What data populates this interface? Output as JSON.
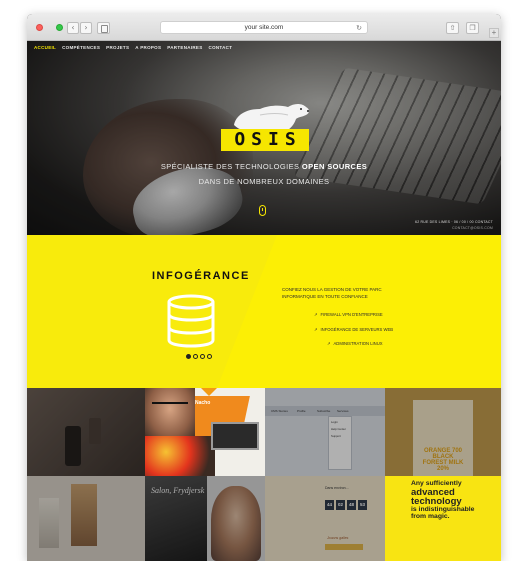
{
  "browser": {
    "url": "your site.com",
    "back_icon": "‹",
    "forward_icon": "›",
    "reload_icon": "↻",
    "share_icon": "⇧",
    "tabs_icon": "❐",
    "newtab_icon": "+"
  },
  "nav": {
    "items": [
      "Accueil",
      "Compétences",
      "Projets",
      "A propos",
      "Partenaires",
      "Contact"
    ],
    "active_index": 0,
    "active_color": "#f6e700"
  },
  "hero": {
    "logo": "OSIS",
    "tagline_prefix": "SPÉCIALISTE DES TECHNOLOGIES ",
    "tagline_highlight": "OPEN SOURCES",
    "tagline_line2": "DANS DE NOMBREUX DOMAINES",
    "contact_phone": "62 RUE DES LIMES · 06 / 00 / 00 CONTACT",
    "contact_email": "CONTACT@OSIS.COM",
    "brand_yellow": "#f6e600"
  },
  "service": {
    "title": "INFOGÉRANCE",
    "intro": "Confiez nous la gestion de votre parc informatique en toute confiance",
    "features": [
      "Firewall VPN d'entreprise",
      "Infogérance de serveurs web",
      "Administration Linux"
    ],
    "slides": 4,
    "active_slide": 0,
    "background": "#f8eb0c"
  },
  "portfolio": {
    "tile2_label": "Nacho",
    "tile3_nav": [
      "CMS Stories",
      "Profile",
      "Subscribe",
      "Services"
    ],
    "tile3_panel": [
      "Login",
      "Help Center",
      "Support"
    ],
    "tile4_text": "ORANGE 700 BLACK FOREST MILK 20%",
    "tile6_text": "Salon, Frydjersk",
    "tile7_date": "Dans environ...",
    "tile7_clock": [
      "44",
      "02",
      "48",
      "53"
    ],
    "tile7_sub": "Jouons galles",
    "tile8_small1": "Any sufficiently",
    "tile8_big1": "advanced",
    "tile8_big2": "technology",
    "tile8_small2": "is indistinguishable",
    "tile8_small3": "from magic."
  }
}
